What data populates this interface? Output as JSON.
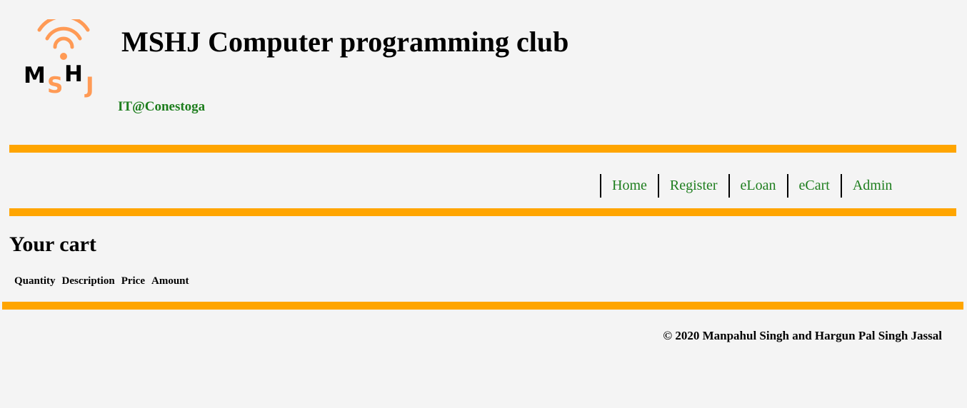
{
  "header": {
    "logo_text": "MSHJ",
    "title": "MSHJ Computer programming club",
    "tagline": "IT@Conestoga"
  },
  "nav": {
    "items": [
      {
        "label": "Home"
      },
      {
        "label": "Register"
      },
      {
        "label": "eLoan"
      },
      {
        "label": "eCart"
      },
      {
        "label": "Admin"
      }
    ]
  },
  "cart": {
    "title": "Your cart",
    "columns": [
      "Quantity",
      "Description",
      "Price",
      "Amount"
    ]
  },
  "footer": {
    "copyright": "© 2020 Manpahul Singh and Hargun Pal Singh Jassal"
  },
  "colors": {
    "accent": "#ffa500",
    "link": "#1e7e1e",
    "logo_orange": "#ff9a55",
    "background": "#f4f4f4"
  }
}
